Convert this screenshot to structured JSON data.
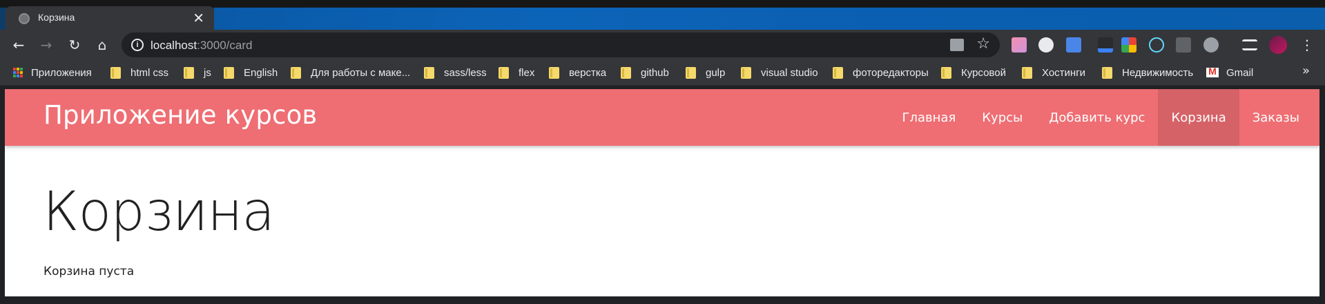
{
  "browser": {
    "tab": {
      "title": "Корзина",
      "close": "✕"
    },
    "nav": {
      "back": "←",
      "forward": "→",
      "reload": "↻",
      "home": "⌂"
    },
    "omnibox": {
      "host": "localhost",
      "rest": ":3000/card",
      "info": "i",
      "star": "☆"
    },
    "bookmarks": {
      "apps_label": "Приложения",
      "folders": [
        "html css",
        "js",
        "English",
        "Для работы с маке...",
        "sass/less",
        "flex",
        "верстка",
        "github",
        "gulp",
        "visual studio",
        "фоторедакторы",
        "Курсовой",
        "Хостинги",
        "Недвижимость"
      ],
      "gmail_label": "Gmail",
      "more": "»"
    },
    "menu": "⋮"
  },
  "app": {
    "brand": "Приложение курсов",
    "nav": [
      {
        "label": "Главная",
        "active": false
      },
      {
        "label": "Курсы",
        "active": false
      },
      {
        "label": "Добавить курс",
        "active": false
      },
      {
        "label": "Корзина",
        "active": true
      },
      {
        "label": "Заказы",
        "active": false
      }
    ],
    "page_title": "Корзина",
    "empty_message": "Корзина пуста"
  },
  "colors": {
    "navbar": "#ee6e73",
    "browser_chrome": "#35363a",
    "text_dark": "#212121"
  }
}
